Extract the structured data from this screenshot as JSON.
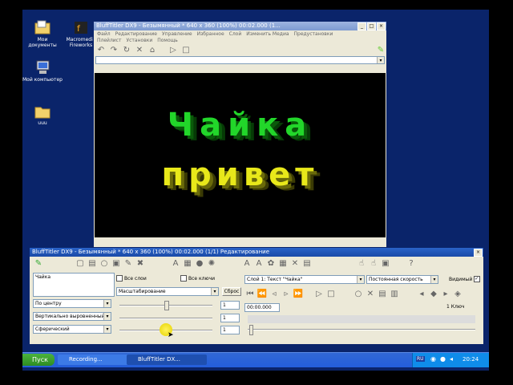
{
  "desktop": {
    "icons": [
      {
        "label": "Мои документы"
      },
      {
        "label": "Macromedia Fireworks"
      },
      {
        "label": "Мой компьютер"
      },
      {
        "label": "uuu"
      }
    ]
  },
  "preview_window": {
    "title": "BluffTitler DX9 - Безымянный * 640 x 360 (100%) 00:02.000 (1...",
    "menu": [
      "Файл",
      "Редактирование",
      "Управление",
      "Избранное",
      "Слой",
      "Изменить Медиа",
      "Предустановки"
    ],
    "menu2": [
      "Плейлист",
      "Установки",
      "Помощь"
    ],
    "title_line1": "Чайка",
    "title_line2": "привет"
  },
  "editor_window": {
    "title": "BluffTitler DX9 - Безымянный * 640 x 360 (100%) 00:02.000 (1/1) Редактирование",
    "text_value": "Чайка",
    "all_layers_label": "Все слои",
    "all_keys_label": "Все ключи",
    "effect_select": "Масштабирование",
    "reset_label": "Сброс",
    "layer_select": "Слой 1: Текст \"Чайка\"",
    "speed_select": "Постоянная скорость",
    "visible_label": "Видимый",
    "align_select": "По центру",
    "vertical_select": "Вертикально выровненный",
    "shape_select": "Сферический",
    "field1": "1",
    "field2": "1",
    "field3": "1",
    "time_value": "00:00.000",
    "keys_count": "1 Ключ"
  },
  "taskbar": {
    "start": "Пуск",
    "items": [
      "Recording...",
      "BluffTitler DX..."
    ],
    "lang": "RU",
    "time": "20:24"
  },
  "colors": {
    "text_green": "#22d62a",
    "text_yellow": "#e8e81a"
  }
}
